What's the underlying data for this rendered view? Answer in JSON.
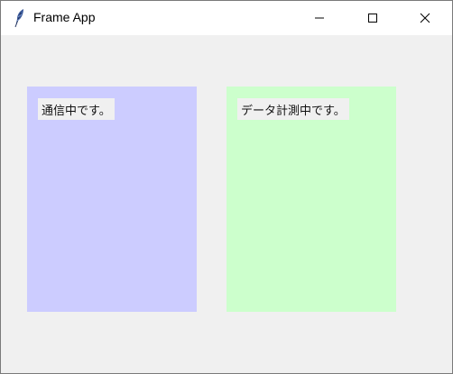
{
  "window": {
    "title": "Frame App"
  },
  "frames": {
    "left": {
      "label": "通信中です。",
      "color": "#ccccff"
    },
    "right": {
      "label": "データ計測中です。",
      "color": "#ccffcc"
    }
  },
  "icons": {
    "app": "feather-icon",
    "minimize": "minimize-icon",
    "maximize": "maximize-icon",
    "close": "close-icon"
  }
}
